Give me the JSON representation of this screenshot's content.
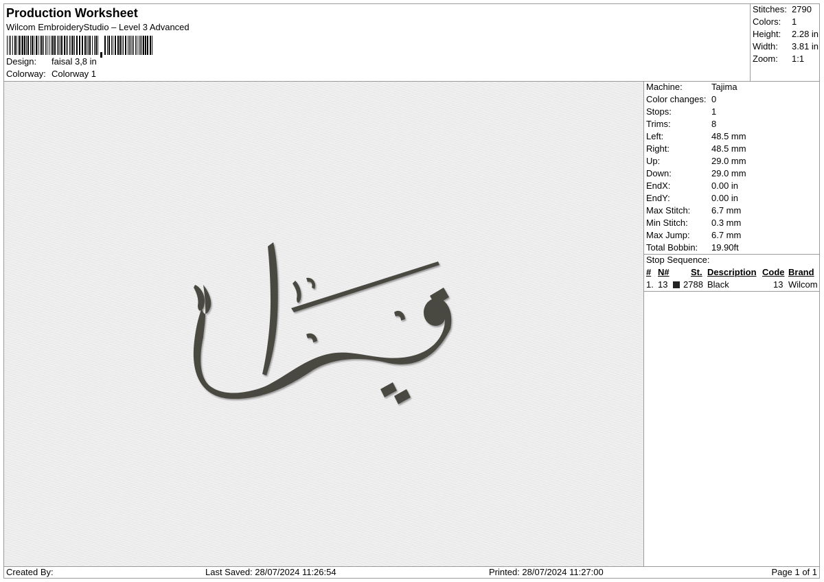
{
  "header": {
    "title": "Production Worksheet",
    "subtitle": "Wilcom EmbroideryStudio – Level 3 Advanced",
    "design_label": "Design:",
    "design_value": "faisal 3,8 in",
    "colorway_label": "Colorway:",
    "colorway_value": "Colorway 1",
    "barcode_icon": "barcode-icon"
  },
  "stats": [
    {
      "label": "Stitches:",
      "value": "2790"
    },
    {
      "label": "Colors:",
      "value": "1"
    },
    {
      "label": "Height:",
      "value": "2.28 in"
    },
    {
      "label": "Width:",
      "value": "3.81 in"
    },
    {
      "label": "Zoom:",
      "value": "1:1"
    }
  ],
  "design_text": "فيصل",
  "thread_color": "#4a4843",
  "info": [
    {
      "label": "Machine:",
      "value": "Tajima"
    },
    {
      "label": "Color changes:",
      "value": "0"
    },
    {
      "label": "Stops:",
      "value": "1"
    },
    {
      "label": "Trims:",
      "value": "8"
    },
    {
      "label": "Left:",
      "value": "48.5 mm"
    },
    {
      "label": "Right:",
      "value": "48.5 mm"
    },
    {
      "label": "Up:",
      "value": "29.0 mm"
    },
    {
      "label": "Down:",
      "value": "29.0 mm"
    },
    {
      "label": "EndX:",
      "value": "0.00 in"
    },
    {
      "label": "EndY:",
      "value": "0.00 in"
    },
    {
      "label": "Max Stitch:",
      "value": "6.7 mm"
    },
    {
      "label": "Min Stitch:",
      "value": "0.3 mm"
    },
    {
      "label": "Max Jump:",
      "value": "6.7 mm"
    },
    {
      "label": "Total Bobbin:",
      "value": "19.90ft"
    }
  ],
  "stop_sequence": {
    "title": "Stop Sequence:",
    "columns": [
      "#",
      "N#",
      "St.",
      "Description",
      "Code",
      "Brand"
    ],
    "rows": [
      {
        "index": "1.",
        "n": "13",
        "swatch_color": "#222222",
        "st": "2788",
        "description": "Black",
        "code": "13",
        "brand": "Wilcom"
      }
    ]
  },
  "footer": {
    "created_by": "Created By:",
    "last_saved": "Last Saved: 28/07/2024 11:26:54",
    "printed": "Printed: 28/07/2024 11:27:00",
    "page": "Page 1 of 1"
  }
}
